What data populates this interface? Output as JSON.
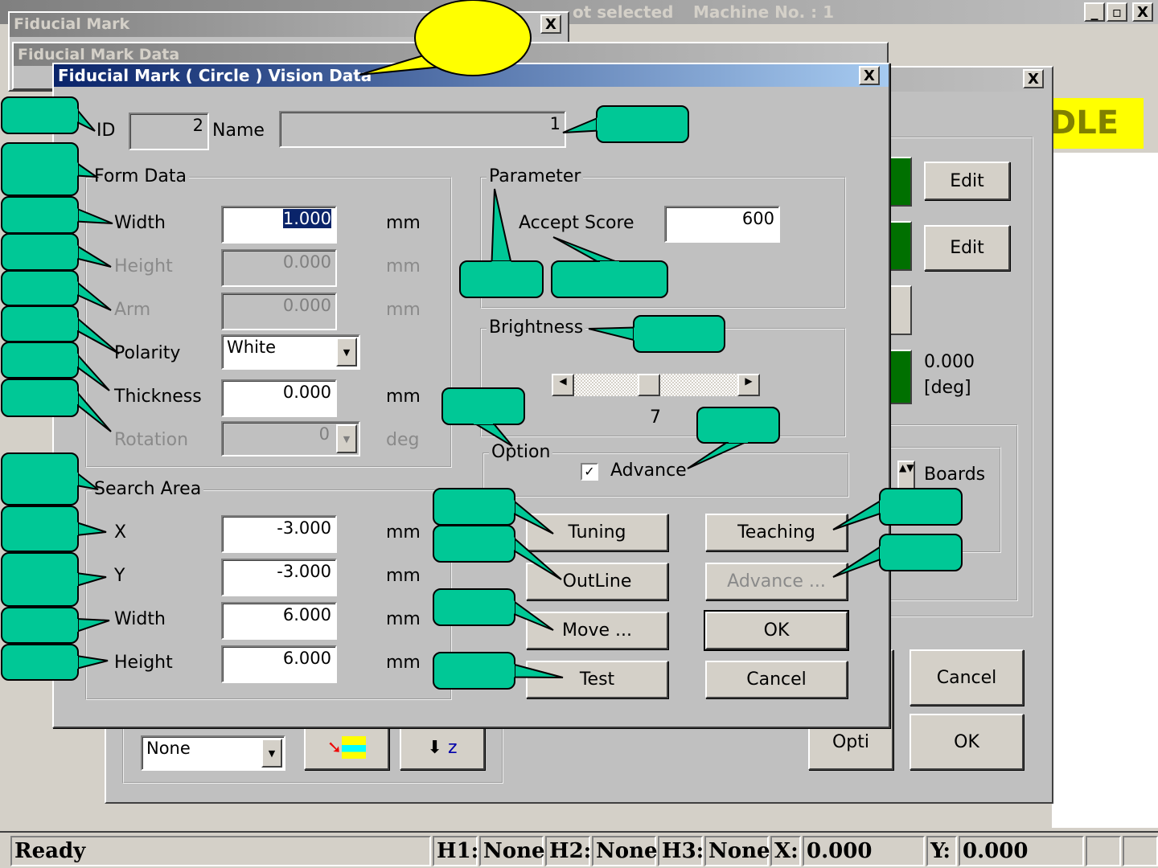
{
  "app": {
    "title_fragment": "ot selected",
    "machine": "Machine No. : 1"
  },
  "windows": {
    "fiducial_mark": "Fiducial Mark",
    "fiducial_mark_data": "Fiducial Mark Data",
    "close": "X"
  },
  "back": {
    "banner": "DLE",
    "edit1": "Edit",
    "edit2": "Edit",
    "angle": "0.000",
    "angle_unit": "[deg]",
    "boards": "Boards",
    "cancel": "Cancel",
    "ok": "OK",
    "opti": "Opti",
    "nozzle_value": "None"
  },
  "dialog": {
    "title": "Fiducial Mark ( Circle ) Vision Data",
    "id_label": "ID",
    "id_value": "2",
    "name_label": "Name",
    "name_value": "1",
    "form_data": {
      "title": "Form Data",
      "rows": [
        {
          "label": "Width",
          "value": "1.000",
          "unit": "mm"
        },
        {
          "label": "Height",
          "value": "0.000",
          "unit": "mm"
        },
        {
          "label": "Arm",
          "value": "0.000",
          "unit": "mm"
        },
        {
          "label": "Polarity",
          "value": "White"
        },
        {
          "label": "Thickness",
          "value": "0.000",
          "unit": "mm"
        },
        {
          "label": "Rotation",
          "value": "0",
          "unit": "deg"
        }
      ]
    },
    "search_area": {
      "title": "Search Area",
      "rows": [
        {
          "label": "X",
          "value": "-3.000",
          "unit": "mm"
        },
        {
          "label": "Y",
          "value": "-3.000",
          "unit": "mm"
        },
        {
          "label": "Width",
          "value": "6.000",
          "unit": "mm"
        },
        {
          "label": "Height",
          "value": "6.000",
          "unit": "mm"
        }
      ]
    },
    "parameter": {
      "title": "Parameter",
      "accept_label": "Accept Score",
      "accept_value": "600"
    },
    "brightness": {
      "title": "Brightness",
      "value": "7",
      "fraction": 0.4
    },
    "option": {
      "title": "Option",
      "advance_label": "Advance",
      "advance_checked": true
    },
    "buttons": {
      "tuning": "Tuning",
      "teaching": "Teaching",
      "outline": "OutLine",
      "advance": "Advance ...",
      "move": "Move ...",
      "ok": "OK",
      "test": "Test",
      "cancel": "Cancel"
    }
  },
  "status": {
    "ready": "Ready",
    "h1": "H1:",
    "h1v": "None",
    "h2": "H2:",
    "h2v": "None",
    "h3": "H3:",
    "h3v": "None",
    "x": "X:",
    "xv": "0.000",
    "y": "Y:",
    "yv": "0.000"
  }
}
